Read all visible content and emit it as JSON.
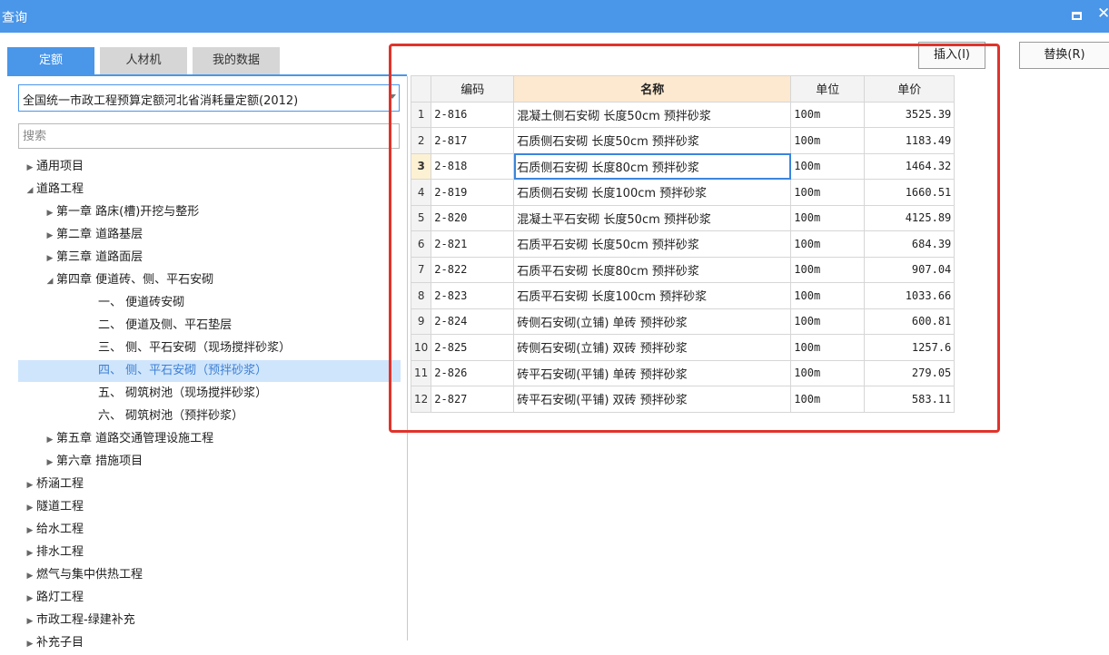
{
  "window": {
    "title": "查询",
    "maximize_icon": "maximize-icon",
    "close_glyph": "✕"
  },
  "tabs": [
    {
      "label": "定额",
      "active": true
    },
    {
      "label": "人材机",
      "active": false
    },
    {
      "label": "我的数据",
      "active": false
    }
  ],
  "library_select": {
    "value": "全国统一市政工程预算定额河北省消耗量定额(2012)"
  },
  "search": {
    "placeholder": "搜索"
  },
  "tree": [
    {
      "label": "通用项目",
      "toggle": "▶",
      "selected": false
    },
    {
      "label": "道路工程",
      "toggle": "◢",
      "selected": false
    },
    {
      "label": "第一章 路床(槽)开挖与整形",
      "toggle": "▶",
      "selected": false
    },
    {
      "label": "第二章 道路基层",
      "toggle": "▶",
      "selected": false
    },
    {
      "label": "第三章 道路面层",
      "toggle": "▶",
      "selected": false
    },
    {
      "label": "第四章 便道砖、侧、平石安砌",
      "toggle": "◢",
      "selected": false
    },
    {
      "label": "一、 便道砖安砌",
      "toggle": "",
      "selected": false
    },
    {
      "label": "二、 便道及侧、平石垫层",
      "toggle": "",
      "selected": false
    },
    {
      "label": "三、 侧、平石安砌（现场搅拌砂浆）",
      "toggle": "",
      "selected": false
    },
    {
      "label": "四、 侧、平石安砌（预拌砂浆）",
      "toggle": "",
      "selected": true
    },
    {
      "label": "五、 砌筑树池（现场搅拌砂浆）",
      "toggle": "",
      "selected": false
    },
    {
      "label": "六、 砌筑树池（预拌砂浆）",
      "toggle": "",
      "selected": false
    },
    {
      "label": "第五章 道路交通管理设施工程",
      "toggle": "▶",
      "selected": false
    },
    {
      "label": "第六章 措施项目",
      "toggle": "▶",
      "selected": false
    },
    {
      "label": "桥涵工程",
      "toggle": "▶",
      "selected": false
    },
    {
      "label": "隧道工程",
      "toggle": "▶",
      "selected": false
    },
    {
      "label": "给水工程",
      "toggle": "▶",
      "selected": false
    },
    {
      "label": "排水工程",
      "toggle": "▶",
      "selected": false
    },
    {
      "label": "燃气与集中供热工程",
      "toggle": "▶",
      "selected": false
    },
    {
      "label": "路灯工程",
      "toggle": "▶",
      "selected": false
    },
    {
      "label": "市政工程-绿建补充",
      "toggle": "▶",
      "selected": false
    },
    {
      "label": "补充子目",
      "toggle": "▶",
      "selected": false
    }
  ],
  "buttons": {
    "insert": "插入(I)",
    "replace": "替换(R)"
  },
  "table": {
    "columns": [
      "编码",
      "名称",
      "单位",
      "单价"
    ],
    "current_row": 3,
    "rows": [
      {
        "no": "1",
        "code": "2-816",
        "name": "混凝土侧石安砌 长度50cm 预拌砂浆",
        "unit": "100m",
        "price": "3525.39"
      },
      {
        "no": "2",
        "code": "2-817",
        "name": "石质侧石安砌 长度50cm 预拌砂浆",
        "unit": "100m",
        "price": "1183.49"
      },
      {
        "no": "3",
        "code": "2-818",
        "name": "石质侧石安砌 长度80cm 预拌砂浆",
        "unit": "100m",
        "price": "1464.32"
      },
      {
        "no": "4",
        "code": "2-819",
        "name": "石质侧石安砌 长度100cm 预拌砂浆",
        "unit": "100m",
        "price": "1660.51"
      },
      {
        "no": "5",
        "code": "2-820",
        "name": "混凝土平石安砌 长度50cm 预拌砂浆",
        "unit": "100m",
        "price": "4125.89"
      },
      {
        "no": "6",
        "code": "2-821",
        "name": "石质平石安砌 长度50cm 预拌砂浆",
        "unit": "100m",
        "price": "684.39"
      },
      {
        "no": "7",
        "code": "2-822",
        "name": "石质平石安砌 长度80cm 预拌砂浆",
        "unit": "100m",
        "price": "907.04"
      },
      {
        "no": "8",
        "code": "2-823",
        "name": "石质平石安砌 长度100cm 预拌砂浆",
        "unit": "100m",
        "price": "1033.66"
      },
      {
        "no": "9",
        "code": "2-824",
        "name": "砖侧石安砌(立铺) 单砖 预拌砂浆",
        "unit": "100m",
        "price": "600.81"
      },
      {
        "no": "10",
        "code": "2-825",
        "name": "砖侧石安砌(立铺) 双砖 预拌砂浆",
        "unit": "100m",
        "price": "1257.6"
      },
      {
        "no": "11",
        "code": "2-826",
        "name": "砖平石安砌(平铺) 单砖 预拌砂浆",
        "unit": "100m",
        "price": "279.05"
      },
      {
        "no": "12",
        "code": "2-827",
        "name": "砖平石安砌(平铺) 双砖 预拌砂浆",
        "unit": "100m",
        "price": "583.11"
      }
    ]
  }
}
